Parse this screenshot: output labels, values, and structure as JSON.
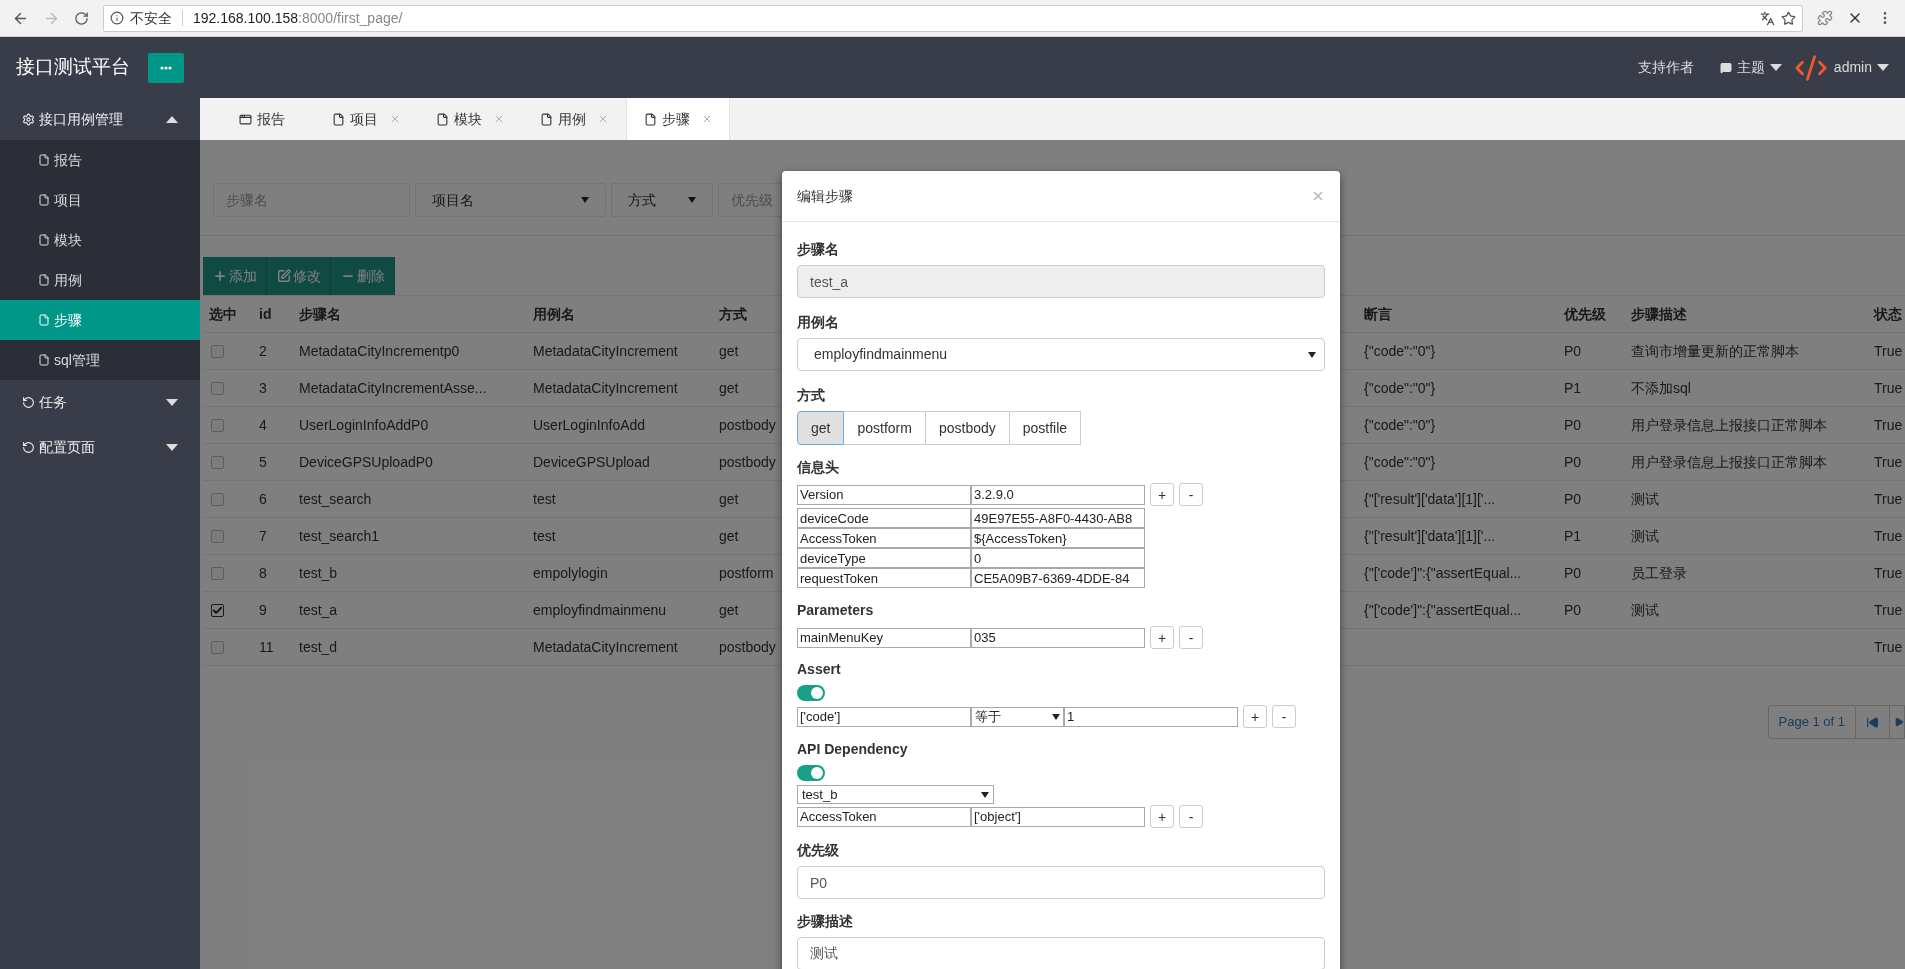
{
  "browser": {
    "security": "不安全",
    "url_host": "192.168.100.158",
    "url_path": ":8000/first_page/"
  },
  "header": {
    "title": "接口测试平台",
    "support": "支持作者",
    "theme": "主题",
    "user": "admin"
  },
  "sidebar": {
    "groups": [
      {
        "label": "接口用例管理",
        "kind": "settings",
        "expanded": true,
        "children": [
          {
            "label": "报告",
            "selected": false
          },
          {
            "label": "项目",
            "selected": false
          },
          {
            "label": "模块",
            "selected": false
          },
          {
            "label": "用例",
            "selected": false
          },
          {
            "label": "步骤",
            "selected": true
          },
          {
            "label": "sql管理",
            "selected": false
          }
        ]
      },
      {
        "label": "任务",
        "kind": "cycle",
        "expanded": false
      },
      {
        "label": "配置页面",
        "kind": "cycle",
        "expanded": false
      }
    ]
  },
  "tabs": [
    {
      "label": "报告",
      "kind": "window",
      "closable": false,
      "selected": false
    },
    {
      "label": "项目",
      "kind": "file",
      "closable": true,
      "selected": false
    },
    {
      "label": "模块",
      "kind": "file",
      "closable": true,
      "selected": false
    },
    {
      "label": "用例",
      "kind": "file",
      "closable": true,
      "selected": false
    },
    {
      "label": "步骤",
      "kind": "file",
      "closable": true,
      "selected": true
    }
  ],
  "filters": [
    {
      "kind": "input",
      "placeholder": "步骤名"
    },
    {
      "kind": "select",
      "placeholder": "项目名"
    },
    {
      "kind": "select",
      "placeholder": "方式"
    },
    {
      "kind": "input",
      "placeholder": "优先级"
    }
  ],
  "actions": [
    {
      "kind": "add",
      "label": "添加"
    },
    {
      "kind": "edit",
      "label": "修改"
    },
    {
      "kind": "delete",
      "label": "删除"
    }
  ],
  "table": {
    "columns": [
      "选中",
      "id",
      "步骤名",
      "用例名",
      "方式",
      "断言",
      "优先级",
      "步骤描述",
      "状态"
    ],
    "rows": [
      {
        "checked": false,
        "id": "2",
        "name": "MetadataCityIncrementp0",
        "case": "MetadataCityIncrement",
        "method": "get",
        "assert": "{\"code\":\"0\"}",
        "priority": "P0",
        "description": "查询市增量更新的正常脚本",
        "status": "True"
      },
      {
        "checked": false,
        "id": "3",
        "name": "MetadataCityIncrementAsse...",
        "case": "MetadataCityIncrement",
        "method": "get",
        "assert": "{\"code\":\"0\"}",
        "priority": "P1",
        "description": "不添加sql",
        "status": "True"
      },
      {
        "checked": false,
        "id": "4",
        "name": "UserLoginInfoAddP0",
        "case": "UserLoginInfoAdd",
        "method": "postbody",
        "assert": "{\"code\":\"0\"}",
        "priority": "P0",
        "description": "用户登录信息上报接口正常脚本",
        "status": "True"
      },
      {
        "checked": false,
        "id": "5",
        "name": "DeviceGPSUploadP0",
        "case": "DeviceGPSUpload",
        "method": "postbody",
        "assert": "{\"code\":\"0\"}",
        "priority": "P0",
        "description": "用户登录信息上报接口正常脚本",
        "status": "True"
      },
      {
        "checked": false,
        "id": "6",
        "name": "test_search",
        "case": "test",
        "method": "get",
        "assert": "{\"['result']['data'][1]['...",
        "priority": "P0",
        "description": "测试",
        "status": "True"
      },
      {
        "checked": false,
        "id": "7",
        "name": "test_search1",
        "case": "test",
        "method": "get",
        "assert": "{\"['result']['data'][1]['...",
        "priority": "P1",
        "description": "测试",
        "status": "True"
      },
      {
        "checked": false,
        "id": "8",
        "name": "test_b",
        "case": "empolylogin",
        "method": "postform",
        "assert": "{\"['code']\":{\"assertEqual...",
        "priority": "P0",
        "description": "员工登录",
        "status": "True"
      },
      {
        "checked": true,
        "id": "9",
        "name": "test_a",
        "case": "employfindmainmenu",
        "method": "get",
        "assert": "{\"['code']\":{\"assertEqual...",
        "priority": "P0",
        "description": "测试",
        "status": "True"
      },
      {
        "checked": false,
        "id": "11",
        "name": "test_d",
        "case": "MetadataCityIncrement",
        "method": "postbody",
        "status": "True"
      }
    ]
  },
  "pagination": {
    "label": "Page 1 of 1"
  },
  "modal": {
    "title": "编辑步骤",
    "step_name": {
      "label": "步骤名",
      "value": "test_a",
      "disabled": true
    },
    "case_name": {
      "label": "用例名",
      "value": "employfindmainmenu"
    },
    "method": {
      "label": "方式",
      "options": [
        {
          "label": "get",
          "selected": true
        },
        {
          "label": "postform",
          "selected": false
        },
        {
          "label": "postbody",
          "selected": false
        },
        {
          "label": "postfile",
          "selected": false
        }
      ]
    },
    "headers": {
      "label": "信息头",
      "buttons": [
        "+",
        "-"
      ],
      "rows": [
        {
          "key": "Version",
          "value": "3.2.9.0"
        },
        {
          "key": "deviceCode",
          "value": "49E97E55-A8F0-4430-AB8"
        },
        {
          "key": "AccessToken",
          "value": "${AccessToken}"
        },
        {
          "key": "deviceType",
          "value": "0"
        },
        {
          "key": "requestToken",
          "value": "CE5A09B7-6369-4DDE-84"
        }
      ]
    },
    "parameters": {
      "label": "Parameters",
      "buttons": [
        "+",
        "-"
      ],
      "rows": [
        {
          "key": "mainMenuKey",
          "value": "035"
        }
      ]
    },
    "assert": {
      "label": "Assert",
      "on": true,
      "buttons": [
        "+",
        "-"
      ],
      "rows": [
        {
          "key": "['code']",
          "operator": "等于",
          "value": "1"
        }
      ]
    },
    "dependency": {
      "label": "API Dependency",
      "on": true,
      "step": "test_b",
      "buttons": [
        "+",
        "-"
      ],
      "rows": [
        {
          "key": "AccessToken",
          "value": "['object']"
        }
      ]
    },
    "priority": {
      "label": "优先级",
      "value": "P0"
    },
    "description": {
      "label": "步骤描述",
      "value": "测试"
    }
  }
}
